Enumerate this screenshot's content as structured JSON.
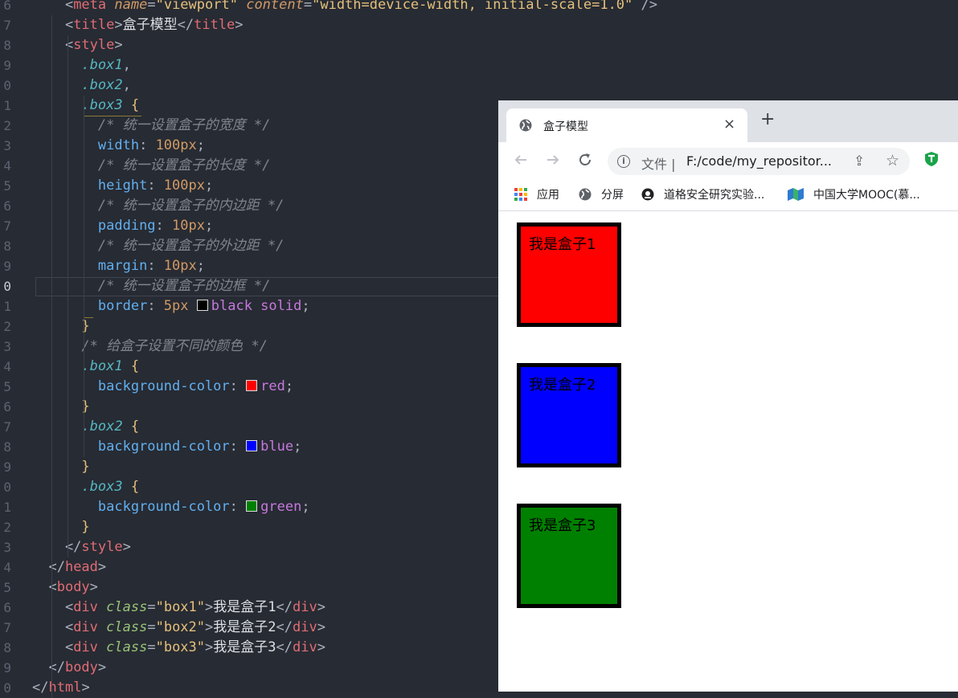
{
  "editor": {
    "lines": [
      {
        "n": "6",
        "tokens": [
          [
            "t-punc",
            "    <"
          ],
          [
            "t-tag",
            "meta"
          ],
          [
            "t-punc",
            " "
          ],
          [
            "t-attr",
            "name"
          ],
          [
            "t-punc",
            "="
          ],
          [
            "t-str",
            "\"viewport\""
          ],
          [
            "t-punc",
            " "
          ],
          [
            "t-attr",
            "content"
          ],
          [
            "t-punc",
            "="
          ],
          [
            "t-str",
            "\"width=device-width, initial-scale=1.0\""
          ],
          [
            "t-punc",
            " />"
          ]
        ]
      },
      {
        "n": "7",
        "tokens": [
          [
            "t-punc",
            "    <"
          ],
          [
            "t-tag",
            "title"
          ],
          [
            "t-punc",
            ">"
          ],
          [
            "t-txt",
            "盒子模型"
          ],
          [
            "t-punc",
            "</"
          ],
          [
            "t-tag",
            "title"
          ],
          [
            "t-punc",
            ">"
          ]
        ]
      },
      {
        "n": "8",
        "tokens": [
          [
            "t-punc",
            "    <"
          ],
          [
            "t-tag",
            "style"
          ],
          [
            "t-punc",
            ">"
          ]
        ]
      },
      {
        "n": "9",
        "tokens": [
          [
            "t-punc",
            "      "
          ],
          [
            "t-sel",
            ".box1"
          ],
          [
            "t-punc",
            ","
          ]
        ]
      },
      {
        "n": "0",
        "tokens": [
          [
            "t-punc",
            "      "
          ],
          [
            "t-sel",
            ".box2"
          ],
          [
            "t-punc",
            ","
          ]
        ]
      },
      {
        "n": "1",
        "tokens": [
          [
            "t-punc",
            "      "
          ],
          [
            "t-sel",
            ".box3"
          ],
          [
            "t-punc",
            " "
          ],
          [
            "t-brace",
            "{"
          ]
        ]
      },
      {
        "n": "2",
        "tokens": [
          [
            "t-punc",
            "        "
          ],
          [
            "t-cmt",
            "/* 统一设置盒子的宽度 */"
          ]
        ]
      },
      {
        "n": "3",
        "tokens": [
          [
            "t-punc",
            "        "
          ],
          [
            "t-prop",
            "width"
          ],
          [
            "t-punc",
            ": "
          ],
          [
            "t-num",
            "100px"
          ],
          [
            "t-punc",
            ";"
          ]
        ]
      },
      {
        "n": "4",
        "tokens": [
          [
            "t-punc",
            "        "
          ],
          [
            "t-cmt",
            "/* 统一设置盒子的长度 */"
          ]
        ]
      },
      {
        "n": "5",
        "tokens": [
          [
            "t-punc",
            "        "
          ],
          [
            "t-prop",
            "height"
          ],
          [
            "t-punc",
            ": "
          ],
          [
            "t-num",
            "100px"
          ],
          [
            "t-punc",
            ";"
          ]
        ]
      },
      {
        "n": "6",
        "tokens": [
          [
            "t-punc",
            "        "
          ],
          [
            "t-cmt",
            "/* 统一设置盒子的内边距 */"
          ]
        ]
      },
      {
        "n": "7",
        "tokens": [
          [
            "t-punc",
            "        "
          ],
          [
            "t-prop",
            "padding"
          ],
          [
            "t-punc",
            ": "
          ],
          [
            "t-num",
            "10px"
          ],
          [
            "t-punc",
            ";"
          ]
        ]
      },
      {
        "n": "8",
        "tokens": [
          [
            "t-punc",
            "        "
          ],
          [
            "t-cmt",
            "/* 统一设置盒子的外边距 */"
          ]
        ]
      },
      {
        "n": "9",
        "tokens": [
          [
            "t-punc",
            "        "
          ],
          [
            "t-prop",
            "margin"
          ],
          [
            "t-punc",
            ": "
          ],
          [
            "t-num",
            "10px"
          ],
          [
            "t-punc",
            ";"
          ]
        ]
      },
      {
        "n": "0",
        "active": true,
        "tokens": [
          [
            "t-punc",
            "        "
          ],
          [
            "t-cmt",
            "/* 统一设置盒子的边框 */"
          ]
        ]
      },
      {
        "n": "1",
        "tokens": [
          [
            "t-punc",
            "        "
          ],
          [
            "t-prop",
            "border"
          ],
          [
            "t-punc",
            ": "
          ],
          [
            "t-num",
            "5px"
          ],
          [
            "t-punc",
            " "
          ],
          [
            "swatch",
            "#000000"
          ],
          [
            "t-val",
            "black solid"
          ],
          [
            "t-punc",
            ";"
          ]
        ]
      },
      {
        "n": "2",
        "tokens": [
          [
            "t-punc",
            "      "
          ],
          [
            "t-brace",
            "}"
          ]
        ]
      },
      {
        "n": "3",
        "tokens": [
          [
            "t-punc",
            "      "
          ],
          [
            "t-cmt",
            "/* 给盒子设置不同的颜色 */"
          ]
        ]
      },
      {
        "n": "4",
        "tokens": [
          [
            "t-punc",
            "      "
          ],
          [
            "t-sel",
            ".box1"
          ],
          [
            "t-punc",
            " "
          ],
          [
            "t-brace",
            "{"
          ]
        ]
      },
      {
        "n": "5",
        "tokens": [
          [
            "t-punc",
            "        "
          ],
          [
            "t-prop",
            "background-color"
          ],
          [
            "t-punc",
            ": "
          ],
          [
            "swatch",
            "#ff0000"
          ],
          [
            "t-val",
            "red"
          ],
          [
            "t-punc",
            ";"
          ]
        ]
      },
      {
        "n": "6",
        "tokens": [
          [
            "t-punc",
            "      "
          ],
          [
            "t-brace",
            "}"
          ]
        ]
      },
      {
        "n": "7",
        "tokens": [
          [
            "t-punc",
            "      "
          ],
          [
            "t-sel",
            ".box2"
          ],
          [
            "t-punc",
            " "
          ],
          [
            "t-brace",
            "{"
          ]
        ]
      },
      {
        "n": "8",
        "tokens": [
          [
            "t-punc",
            "        "
          ],
          [
            "t-prop",
            "background-color"
          ],
          [
            "t-punc",
            ": "
          ],
          [
            "swatch",
            "#0000ff"
          ],
          [
            "t-val",
            "blue"
          ],
          [
            "t-punc",
            ";"
          ]
        ]
      },
      {
        "n": "9",
        "tokens": [
          [
            "t-punc",
            "      "
          ],
          [
            "t-brace",
            "}"
          ]
        ]
      },
      {
        "n": "0",
        "tokens": [
          [
            "t-punc",
            "      "
          ],
          [
            "t-sel",
            ".box3"
          ],
          [
            "t-punc",
            " "
          ],
          [
            "t-brace",
            "{"
          ]
        ]
      },
      {
        "n": "1",
        "tokens": [
          [
            "t-punc",
            "        "
          ],
          [
            "t-prop",
            "background-color"
          ],
          [
            "t-punc",
            ": "
          ],
          [
            "swatch",
            "#008000"
          ],
          [
            "t-val",
            "green"
          ],
          [
            "t-punc",
            ";"
          ]
        ]
      },
      {
        "n": "2",
        "tokens": [
          [
            "t-punc",
            "      "
          ],
          [
            "t-brace",
            "}"
          ]
        ]
      },
      {
        "n": "3",
        "tokens": [
          [
            "t-punc",
            "    </"
          ],
          [
            "t-tag",
            "style"
          ],
          [
            "t-punc",
            ">"
          ]
        ]
      },
      {
        "n": "4",
        "tokens": [
          [
            "t-punc",
            "  </"
          ],
          [
            "t-tag",
            "head"
          ],
          [
            "t-punc",
            ">"
          ]
        ]
      },
      {
        "n": "5",
        "tokens": [
          [
            "t-punc",
            "  <"
          ],
          [
            "t-tag",
            "body"
          ],
          [
            "t-punc",
            ">"
          ]
        ]
      },
      {
        "n": "6",
        "tokens": [
          [
            "t-punc",
            "    <"
          ],
          [
            "t-tag",
            "div"
          ],
          [
            "t-punc",
            " "
          ],
          [
            "t-sel2",
            "class"
          ],
          [
            "t-punc",
            "="
          ],
          [
            "t-str",
            "\"box1\""
          ],
          [
            "t-punc",
            ">"
          ],
          [
            "t-txt",
            "我是盒子1"
          ],
          [
            "t-punc",
            "</"
          ],
          [
            "t-tag",
            "div"
          ],
          [
            "t-punc",
            ">"
          ]
        ]
      },
      {
        "n": "7",
        "tokens": [
          [
            "t-punc",
            "    <"
          ],
          [
            "t-tag",
            "div"
          ],
          [
            "t-punc",
            " "
          ],
          [
            "t-sel2",
            "class"
          ],
          [
            "t-punc",
            "="
          ],
          [
            "t-str",
            "\"box2\""
          ],
          [
            "t-punc",
            ">"
          ],
          [
            "t-txt",
            "我是盒子2"
          ],
          [
            "t-punc",
            "</"
          ],
          [
            "t-tag",
            "div"
          ],
          [
            "t-punc",
            ">"
          ]
        ]
      },
      {
        "n": "8",
        "tokens": [
          [
            "t-punc",
            "    <"
          ],
          [
            "t-tag",
            "div"
          ],
          [
            "t-punc",
            " "
          ],
          [
            "t-sel2",
            "class"
          ],
          [
            "t-punc",
            "="
          ],
          [
            "t-str",
            "\"box3\""
          ],
          [
            "t-punc",
            ">"
          ],
          [
            "t-txt",
            "我是盒子3"
          ],
          [
            "t-punc",
            "</"
          ],
          [
            "t-tag",
            "div"
          ],
          [
            "t-punc",
            ">"
          ]
        ]
      },
      {
        "n": "9",
        "tokens": [
          [
            "t-punc",
            "  </"
          ],
          [
            "t-tag",
            "body"
          ],
          [
            "t-punc",
            ">"
          ]
        ]
      },
      {
        "n": "0",
        "tokens": [
          [
            "t-punc",
            "</"
          ],
          [
            "t-tag",
            "html"
          ],
          [
            "t-punc",
            ">"
          ]
        ]
      }
    ]
  },
  "browser": {
    "tab_title": "盒子模型",
    "tab_close": "×",
    "new_tab": "+",
    "url_prefix": "文件 |",
    "url": "F:/code/my_repositor...",
    "bookmarks": [
      {
        "label": "应用"
      },
      {
        "label": "分屏"
      },
      {
        "label": "道格安全研究实验..."
      },
      {
        "label": "中国大学MOOC(慕..."
      }
    ],
    "boxes": [
      {
        "label": "我是盒子1",
        "color": "#ff0000"
      },
      {
        "label": "我是盒子2",
        "color": "#0000ff"
      },
      {
        "label": "我是盒子3",
        "color": "#008000"
      }
    ]
  }
}
